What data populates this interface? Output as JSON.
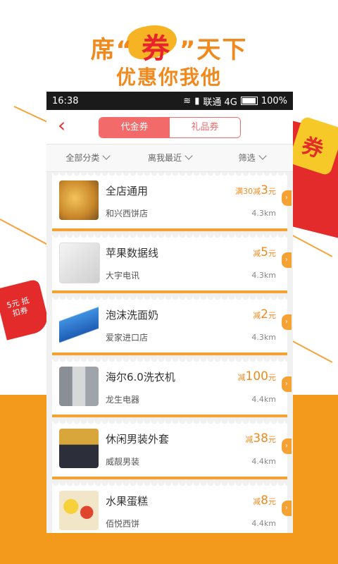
{
  "promo": {
    "line1_left": "席",
    "line1_quote_open": "“",
    "line1_highlight": "券",
    "line1_quote_close": "”",
    "line1_right": "天下",
    "line2": "优惠你我他"
  },
  "decor": {
    "right_badge": "券",
    "left_badge": "5元 抵扣券"
  },
  "status_bar": {
    "time": "16:38",
    "carrier": "联通 4G",
    "battery": "100%"
  },
  "nav": {
    "tabs": [
      {
        "label": "代金券",
        "active": true
      },
      {
        "label": "礼品券",
        "active": false
      }
    ]
  },
  "filters": [
    {
      "label": "全部分类"
    },
    {
      "label": "离我最近"
    },
    {
      "label": "筛选"
    }
  ],
  "coupons": [
    {
      "name": "全店通用",
      "shop": "和兴西饼店",
      "price_prefix": "满30减",
      "price_amount": "3",
      "price_unit": "元",
      "distance": "4.3km"
    },
    {
      "name": "苹果数据线",
      "shop": "大宇电讯",
      "price_prefix": "减",
      "price_amount": "5",
      "price_unit": "元",
      "distance": "4.3km"
    },
    {
      "name": "泡沫洗面奶",
      "shop": "爱家进口店",
      "price_prefix": "减",
      "price_amount": "2",
      "price_unit": "元",
      "distance": "4.3km"
    },
    {
      "name": "海尔6.0洗衣机",
      "shop": "龙生电器",
      "price_prefix": "减",
      "price_amount": "100",
      "price_unit": "元",
      "distance": "4.4km"
    },
    {
      "name": "休闲男装外套",
      "shop": "威靓男装",
      "price_prefix": "减",
      "price_amount": "38",
      "price_unit": "元",
      "distance": "4.4km"
    },
    {
      "name": "水果蛋糕",
      "shop": "佰悦西饼",
      "price_prefix": "减",
      "price_amount": "8",
      "price_unit": "元",
      "distance": "4.4km"
    }
  ],
  "colors": {
    "accent_orange": "#f08a1e",
    "accent_red": "#e42b2b",
    "tab_red": "#f26a6a"
  }
}
